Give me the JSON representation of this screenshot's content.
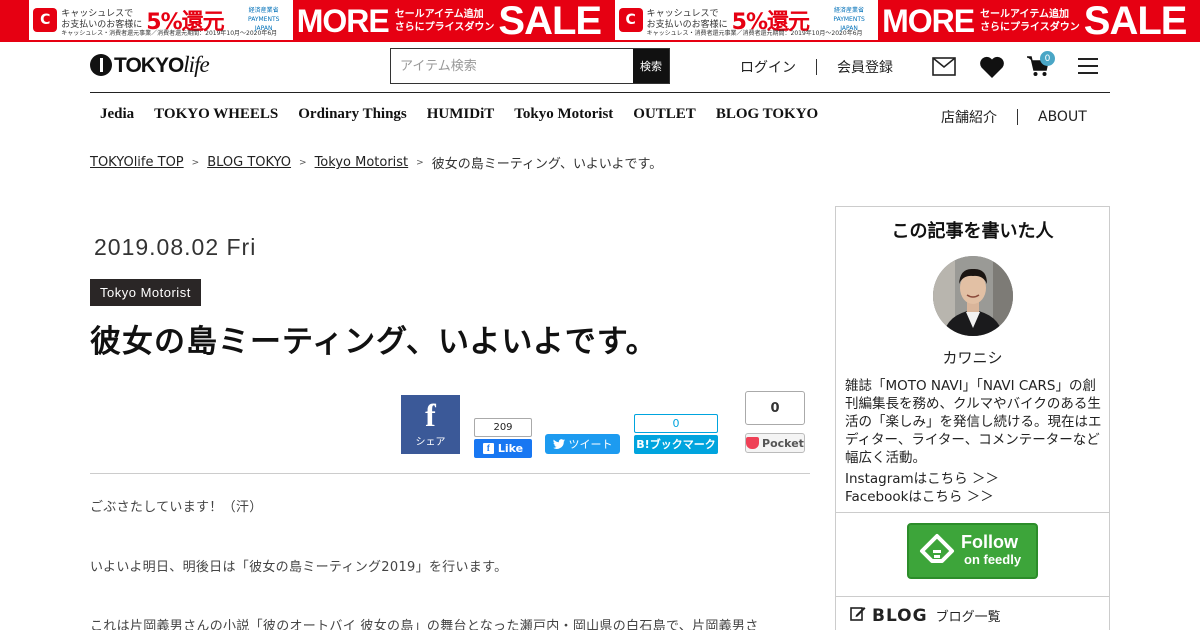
{
  "banner": {
    "cashless_icon": "C",
    "cashless_line1": "キャッシュレスで",
    "cashless_line2": "お支払いのお客様に",
    "cashless_percent": "5%還元",
    "cashless_sub": "キャッシュレス・消費者還元事業／消費者還元期間：2019年10月〜2020年6月",
    "cashless_ministry": "経済産業省",
    "cashless_payments": "PAYMENTS JAPAN",
    "more": "MORE",
    "sale_line1": "セールアイテム追加",
    "sale_line2": "さらにプライスダウン",
    "sale": "SALE",
    "colors": {
      "red": "#e60012"
    }
  },
  "header": {
    "logo_main": "TOKYO",
    "logo_script": "life",
    "search_placeholder": "アイテム検索",
    "search_button": "検索",
    "login": "ログイン",
    "register": "会員登録",
    "cart_count": "0",
    "icons": [
      "mail-icon",
      "heart-icon",
      "cart-icon",
      "menu-icon"
    ]
  },
  "nav": {
    "items": [
      "Jedia",
      "TOKYO WHEELS",
      "Ordinary Things",
      "HUMIDiT",
      "Tokyo Motorist",
      "OUTLET",
      "BLOG TOKYO"
    ],
    "stores": "店舗紹介",
    "about": "ABOUT"
  },
  "breadcrumb": {
    "items": [
      "TOKYOlife TOP",
      "BLOG TOKYO",
      "Tokyo Motorist"
    ],
    "current": "彼女の島ミーティング、いよいよです。",
    "separator": ">"
  },
  "article": {
    "date": "2019.08.02 Fri",
    "category": "Tokyo Motorist",
    "title": "彼女の島ミーティング、いよいよです。",
    "paragraphs": [
      "ごぶさたしています！（汗）",
      "いよいよ明日、明後日は「彼女の島ミーティング2019」を行います。",
      "これは片岡義男さんの小説「彼のオートバイ 彼女の島」の舞台となった瀬戸内・岡山県の白石島で、片岡義男さ"
    ]
  },
  "share": {
    "facebook_label": "シェア",
    "like_count": "209",
    "like_label": "Like",
    "tweet_label": "ツイート",
    "hatena_count": "0",
    "hatena_label": "B!ブックマーク",
    "pocket_count": "0",
    "pocket_label": "Pocket"
  },
  "sidebar": {
    "heading": "この記事を書いた人",
    "author": "カワニシ",
    "bio": "雑誌「MOTO NAVI」「NAVI CARS」の創刊編集長を務め、クルマやバイクのある生活の「楽しみ」を発信し続ける。現在はエディター、ライター、コメンテーターなど幅広く活動。",
    "instagram": "Instagramはこちら ＞＞",
    "facebook": "Facebookはこちら ＞＞",
    "feedly_line1": "Follow",
    "feedly_line2": "on feedly",
    "blog_title": "BLOG",
    "blog_sub": "ブログ一覧"
  }
}
